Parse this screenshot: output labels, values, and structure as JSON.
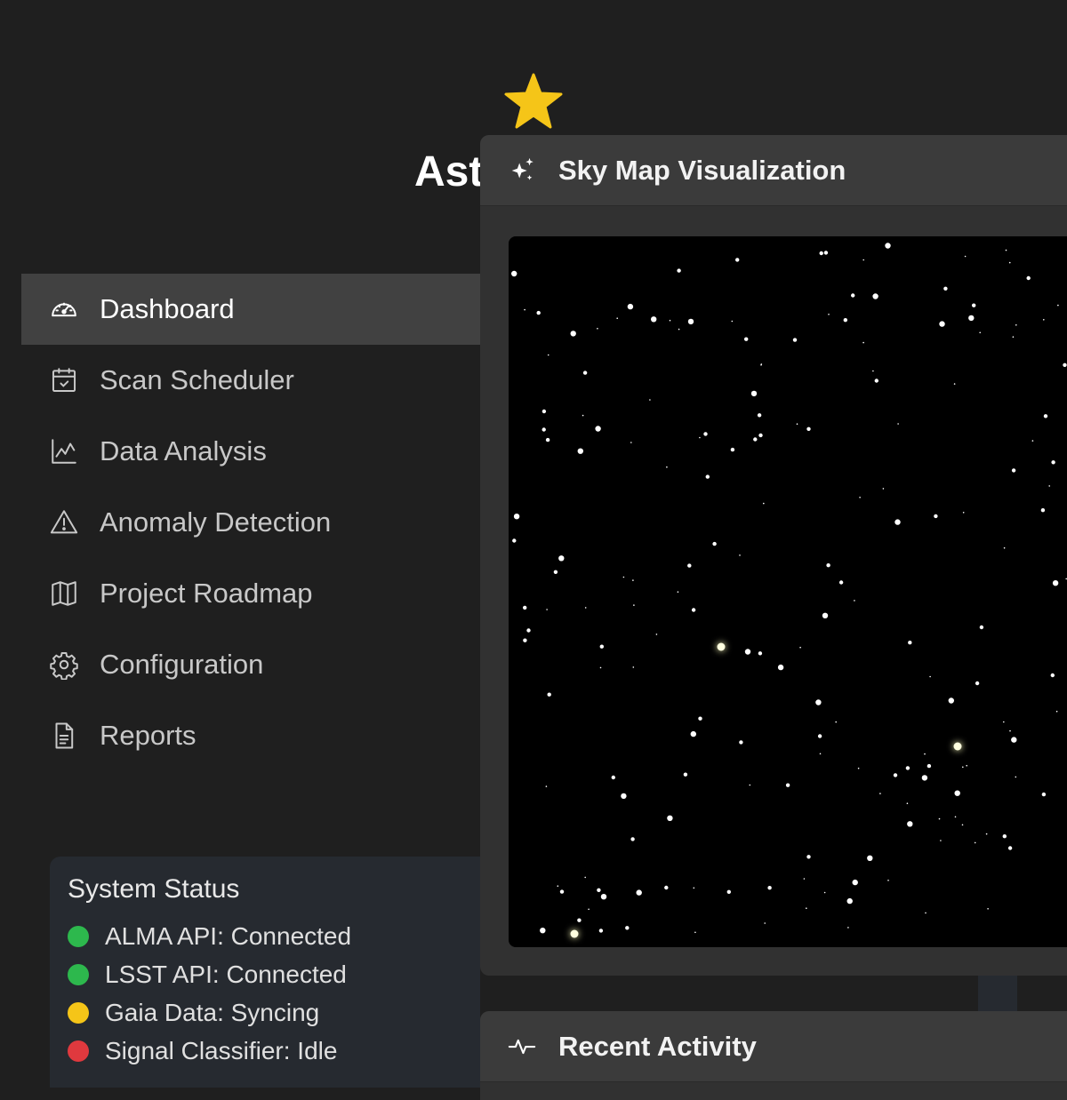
{
  "app": {
    "title": "Ast"
  },
  "sidebar": {
    "items": [
      {
        "label": "Dashboard",
        "icon": "dashboard-gauge-icon",
        "active": true
      },
      {
        "label": "Scan Scheduler",
        "icon": "calendar-check-icon",
        "active": false
      },
      {
        "label": "Data Analysis",
        "icon": "line-chart-icon",
        "active": false
      },
      {
        "label": "Anomaly Detection",
        "icon": "warning-triangle-icon",
        "active": false
      },
      {
        "label": "Project Roadmap",
        "icon": "map-icon",
        "active": false
      },
      {
        "label": "Configuration",
        "icon": "gear-icon",
        "active": false
      },
      {
        "label": "Reports",
        "icon": "document-icon",
        "active": false
      }
    ]
  },
  "status": {
    "title": "System Status",
    "items": [
      {
        "text": "ALMA API: Connected",
        "color": "#2db84d"
      },
      {
        "text": "LSST API: Connected",
        "color": "#2db84d"
      },
      {
        "text": "Gaia Data: Syncing",
        "color": "#f5c518"
      },
      {
        "text": "Signal Classifier: Idle",
        "color": "#e0393e"
      }
    ]
  },
  "skymap": {
    "title": "Sky Map Visualization",
    "icon": "sparkles-icon"
  },
  "activity": {
    "title": "Recent Activity",
    "icon": "pulse-icon"
  },
  "colors": {
    "accent_star": "#f5c518",
    "active_nav_bg": "#414141",
    "panel_bg": "#313131"
  }
}
